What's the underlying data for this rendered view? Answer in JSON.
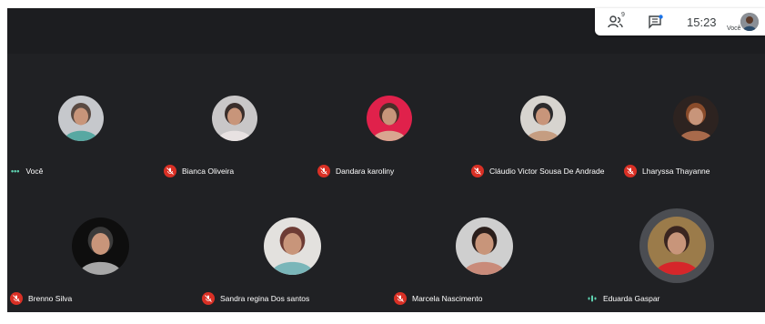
{
  "toolbar": {
    "people_icon": "people-icon",
    "people_badge": "9",
    "chat_icon": "chat-icon",
    "time": "15:23",
    "you_label": "Você"
  },
  "participants": [
    {
      "name": "Você",
      "status": "more-options",
      "colors": [
        "#c6c8cc",
        "#5a4a42",
        "#58a8a2"
      ]
    },
    {
      "name": "Bianca Oliveira",
      "status": "muted",
      "colors": [
        "#c9c7c8",
        "#3a2e2b",
        "#e8e2e2"
      ]
    },
    {
      "name": "Dandara karoliny",
      "status": "muted",
      "colors": [
        "#e0214b",
        "#4a2f28",
        "#d9a590"
      ]
    },
    {
      "name": "Cláudio Victor Sousa De Andrade",
      "status": "muted",
      "colors": [
        "#d7d4cf",
        "#2b2a2c",
        "#c59d81"
      ]
    },
    {
      "name": "Lharyssa Thayanne",
      "status": "muted",
      "colors": [
        "#2d2320",
        "#8a4c2b",
        "#a86a4b"
      ]
    },
    {
      "name": "Brenno Silva",
      "status": "muted",
      "colors": [
        "#0e0e0e",
        "#3a3a3a",
        "#a7a7a7"
      ]
    },
    {
      "name": "Sandra regina Dos santos",
      "status": "muted",
      "colors": [
        "#e3e1de",
        "#6d3b34",
        "#7ab6b9"
      ]
    },
    {
      "name": "Marcela Nascimento",
      "status": "muted",
      "colors": [
        "#cfcfcf",
        "#2a1e1b",
        "#c98b7a"
      ]
    },
    {
      "name": "Eduarda Gaspar",
      "status": "speaking",
      "colors": [
        "#9b7b4a",
        "#3a2520",
        "#d6262a"
      ]
    }
  ],
  "accent": {
    "muted": "#d93025",
    "speaking": "#5fd3b1"
  }
}
